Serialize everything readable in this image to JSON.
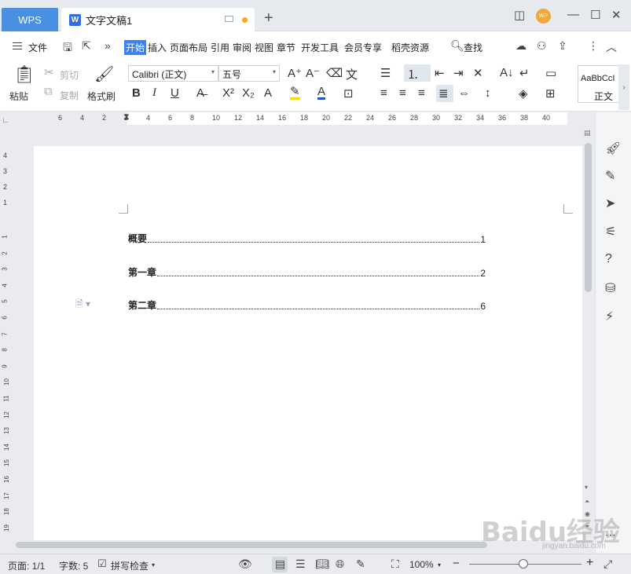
{
  "titlebar": {
    "app_tab": "WPS",
    "doc_tab": "文字文稿1",
    "new_tab": "+",
    "avatar": "WP"
  },
  "menubar": {
    "file": "文件",
    "more": "»",
    "tabs": [
      "开始",
      "插入",
      "页面布局",
      "引用",
      "审阅",
      "视图",
      "章节",
      "开发工具",
      "会员专享",
      "稻壳资源"
    ],
    "search": "查找"
  },
  "ribbon": {
    "paste": "粘贴",
    "cut": "剪切",
    "copy": "复制",
    "format_painter": "格式刷",
    "font_name": "Calibri (正文)",
    "font_size": "五号",
    "style_preview": "AaBbCcI",
    "style_name": "正文"
  },
  "ruler": {
    "h_ticks": [
      "6",
      "4",
      "2",
      "2",
      "4",
      "6",
      "8",
      "10",
      "12",
      "14",
      "16",
      "18",
      "20",
      "22",
      "24",
      "26",
      "28",
      "30",
      "32",
      "34",
      "36",
      "38",
      "40"
    ],
    "v_ticks_top": [
      "4",
      "3",
      "2",
      "1"
    ],
    "v_ticks": [
      "1",
      "2",
      "3",
      "4",
      "5",
      "6",
      "7",
      "8",
      "9",
      "10",
      "11",
      "12",
      "13",
      "14",
      "15",
      "16",
      "17",
      "18",
      "19"
    ]
  },
  "document": {
    "toc": [
      {
        "title": "概要",
        "page": "1"
      },
      {
        "title": "第一章",
        "page": "2"
      },
      {
        "title": "第二章",
        "page": "6"
      }
    ]
  },
  "statusbar": {
    "page": "页面: 1/1",
    "words": "字数: 5",
    "spell": "拼写检查",
    "zoom": "100%",
    "zoom_level_percent": 100
  },
  "watermark": {
    "main": "Baidu经验",
    "sub": "jingyan.baidu.com"
  },
  "colors": {
    "accent": "#3b82f6",
    "wps_tab": "#4a90e2",
    "unsaved_dot": "#f5a623"
  }
}
